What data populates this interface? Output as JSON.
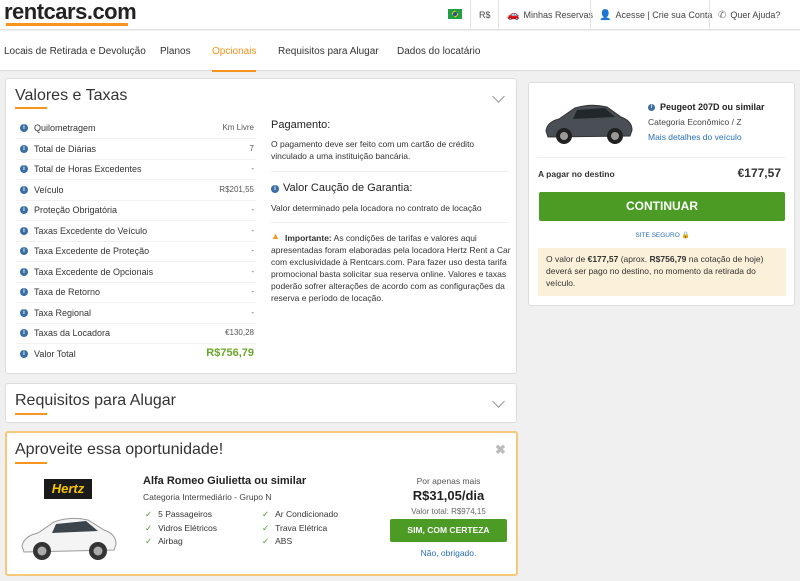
{
  "header": {
    "logo": "rentcars.com",
    "currency": "R$",
    "reservations": "Minhas Reservas",
    "account": "Acesse | Crie sua Conta",
    "help": "Quer Ajuda?"
  },
  "nav": {
    "items": [
      "Locais de Retirada e Devolução",
      "Planos",
      "Opcionais",
      "Requisitos para Alugar",
      "Dados do locatário"
    ],
    "active": "Opcionais"
  },
  "fees": {
    "title": "Valores e Taxas",
    "rows": [
      {
        "label": "Quilometragem",
        "value": "Km Livre"
      },
      {
        "label": "Total de Diárias",
        "value": "7"
      },
      {
        "label": "Total de Horas Excedentes",
        "value": "-"
      },
      {
        "label": "Veículo",
        "value": "R$201,55"
      },
      {
        "label": "Proteção Obrigatória",
        "value": "-"
      },
      {
        "label": "Taxas Excedente do Veículo",
        "value": "-"
      },
      {
        "label": "Taxa Excedente de Proteção",
        "value": "-"
      },
      {
        "label": "Taxa Excedente de Opcionais",
        "value": "-"
      },
      {
        "label": "Taxa de Retorno",
        "value": "-"
      },
      {
        "label": "Taxa Regional",
        "value": "-"
      },
      {
        "label": "Taxas da Locadora",
        "value": "€130,28"
      }
    ],
    "total_label": "Valor Total",
    "total_value": "R$756,79",
    "payment_title": "Pagamento:",
    "payment_text": "O pagamento deve ser feito com um cartão de crédito vinculado a uma instituição bancária.",
    "deposit_title": "Valor Caução de Garantia:",
    "deposit_text": "Valor determinado pela locadora no contrato de locação",
    "important_label": "Importante:",
    "important_text": "As condições de tarifas e valores aqui apresentadas foram elaboradas pela locadora Hertz Rent a Car com exclusividade à Rentcars.com. Para fazer uso desta tarifa promocional basta solicitar sua reserva online. Valores e taxas poderão sofrer alterações de acordo com as configurações da reserva e período de locação."
  },
  "requirements": {
    "title": "Requisitos para Alugar"
  },
  "offer": {
    "title": "Aproveite essa oportunidade!",
    "brand": "Hertz",
    "car_name": "Alfa Romeo Giulietta ou similar",
    "category": "Categoria Intermediário - Grupo N",
    "features_left": [
      "5 Passageiros",
      "Vidros Elétricos",
      "Airbag"
    ],
    "features_right": [
      "Ar Condicionado",
      "Trava Elétrica",
      "ABS"
    ],
    "price_prefix": "Por apenas mais",
    "price": "R$31,05/dia",
    "total": "Valor total: R$974,15",
    "accept": "SIM, COM CERTEZA",
    "decline": "Não, obrigado."
  },
  "summary": {
    "car_name": "Peugeot 207D ou similar",
    "category": "Categoria Econômico / Z",
    "details_link": "Mais detalhes do veículo",
    "pay_label": "A pagar no destino",
    "pay_value": "€177,57",
    "continue": "CONTINUAR",
    "secure": "SITE SEGURO",
    "note_prefix": "O valor de",
    "note_eur": "€177,57",
    "note_mid": "(aprox.",
    "note_brl": "R$756,79",
    "note_suffix": "na cotação de hoje) deverá ser pago no destino, no momento da retirada do veículo."
  },
  "colors": {
    "accent": "#f7941d",
    "green": "#4b9b24",
    "link": "#2a6ebb",
    "info": "#3a6ea5",
    "note_bg": "#fbf0d9"
  }
}
